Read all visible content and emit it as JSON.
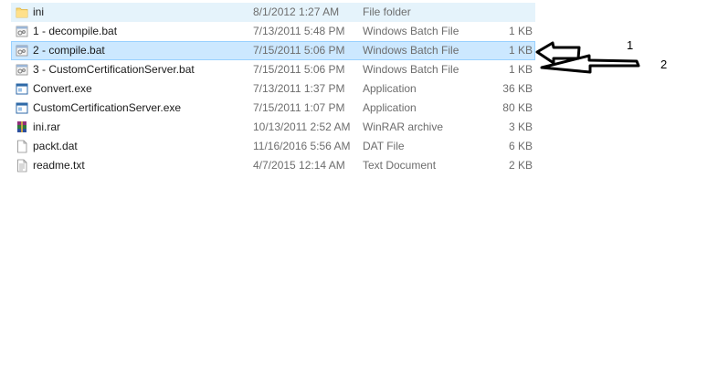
{
  "files": [
    {
      "name": "ini",
      "date": "8/1/2012 1:27 AM",
      "type": "File folder",
      "size": "",
      "icon": "folder-icon"
    },
    {
      "name": "1 - decompile.bat",
      "date": "7/13/2011 5:48 PM",
      "type": "Windows Batch File",
      "size": "1 KB",
      "icon": "batch-file-icon"
    },
    {
      "name": "2 - compile.bat",
      "date": "7/15/2011 5:06 PM",
      "type": "Windows Batch File",
      "size": "1 KB",
      "icon": "batch-file-icon"
    },
    {
      "name": "3 - CustomCertificationServer.bat",
      "date": "7/15/2011 5:06 PM",
      "type": "Windows Batch File",
      "size": "1 KB",
      "icon": "batch-file-icon"
    },
    {
      "name": "Convert.exe",
      "date": "7/13/2011 1:37 PM",
      "type": "Application",
      "size": "36 KB",
      "icon": "application-icon"
    },
    {
      "name": "CustomCertificationServer.exe",
      "date": "7/15/2011 1:07 PM",
      "type": "Application",
      "size": "80 KB",
      "icon": "application-icon"
    },
    {
      "name": "ini.rar",
      "date": "10/13/2011 2:52 AM",
      "type": "WinRAR archive",
      "size": "3 KB",
      "icon": "winrar-archive-icon"
    },
    {
      "name": "packt.dat",
      "date": "11/16/2016 5:56 AM",
      "type": "DAT File",
      "size": "6 KB",
      "icon": "document-icon"
    },
    {
      "name": "readme.txt",
      "date": "4/7/2015 12:14 AM",
      "type": "Text Document",
      "size": "2 KB",
      "icon": "text-document-icon"
    }
  ],
  "annotations": {
    "label_1": "1",
    "label_2": "2"
  },
  "colors": {
    "hover": "#e5f3fb",
    "selected": "#cce8ff",
    "selected_border": "#99d1ff"
  }
}
